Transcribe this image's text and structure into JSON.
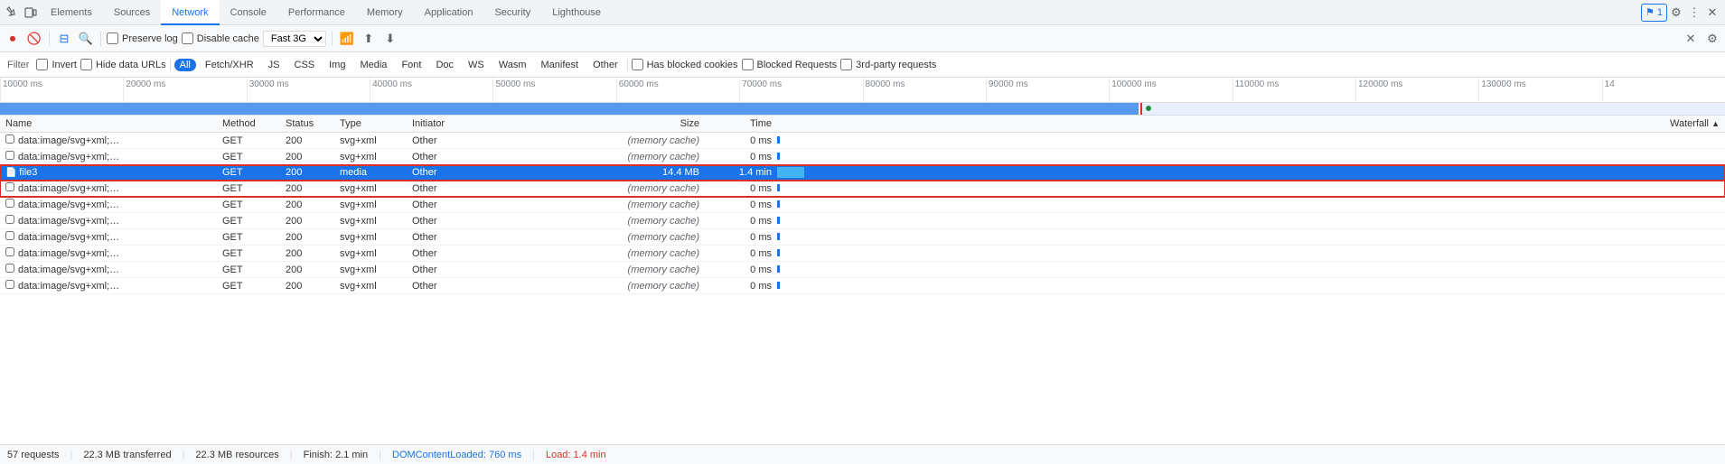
{
  "tabs": [
    {
      "label": "Elements",
      "active": false
    },
    {
      "label": "Sources",
      "active": false
    },
    {
      "label": "Network",
      "active": true,
      "hasWarning": false
    },
    {
      "label": "Console",
      "active": false
    },
    {
      "label": "Performance",
      "active": false
    },
    {
      "label": "Memory",
      "active": false
    },
    {
      "label": "Application",
      "active": false
    },
    {
      "label": "Security",
      "active": false
    },
    {
      "label": "Lighthouse",
      "active": false
    }
  ],
  "toolbar": {
    "preserve_log": "Preserve log",
    "disable_cache": "Disable cache",
    "throttle": "Fast 3G"
  },
  "filter": {
    "label": "Filter",
    "invert": "Invert",
    "hide_data_urls": "Hide data URLs",
    "chips": [
      "All",
      "Fetch/XHR",
      "JS",
      "CSS",
      "Img",
      "Media",
      "Font",
      "Doc",
      "WS",
      "Wasm",
      "Manifest",
      "Other"
    ],
    "active_chip": "All",
    "has_blocked_cookies": "Has blocked cookies",
    "blocked_requests": "Blocked Requests",
    "third_party": "3rd-party requests"
  },
  "timeline": {
    "marks": [
      "10000 ms",
      "20000 ms",
      "30000 ms",
      "40000 ms",
      "50000 ms",
      "60000 ms",
      "70000 ms",
      "80000 ms",
      "90000 ms",
      "100000 ms",
      "110000 ms",
      "120000 ms",
      "130000 ms",
      "14"
    ]
  },
  "table": {
    "columns": [
      "Name",
      "Method",
      "Status",
      "Type",
      "Initiator",
      "Size",
      "Time",
      "Waterfall"
    ],
    "rows": [
      {
        "name": "data:image/svg+xml;…",
        "method": "GET",
        "status": "200",
        "type": "svg+xml",
        "initiator": "Other",
        "size": "(memory cache)",
        "time": "0 ms",
        "selected": false,
        "hasIcon": false
      },
      {
        "name": "data:image/svg+xml;…",
        "method": "GET",
        "status": "200",
        "type": "svg+xml",
        "initiator": "Other",
        "size": "(memory cache)",
        "time": "0 ms",
        "selected": false,
        "hasIcon": false
      },
      {
        "name": "file3",
        "method": "GET",
        "status": "200",
        "type": "media",
        "initiator": "Other",
        "size": "14.4 MB",
        "time": "1.4 min",
        "selected": true,
        "hasIcon": true,
        "redBox": true
      },
      {
        "name": "data:image/svg+xml;…",
        "method": "GET",
        "status": "200",
        "type": "svg+xml",
        "initiator": "Other",
        "size": "(memory cache)",
        "time": "0 ms",
        "selected": false,
        "hasIcon": false,
        "redBox": true
      },
      {
        "name": "data:image/svg+xml;…",
        "method": "GET",
        "status": "200",
        "type": "svg+xml",
        "initiator": "Other",
        "size": "(memory cache)",
        "time": "0 ms",
        "selected": false,
        "hasIcon": false
      },
      {
        "name": "data:image/svg+xml;…",
        "method": "GET",
        "status": "200",
        "type": "svg+xml",
        "initiator": "Other",
        "size": "(memory cache)",
        "time": "0 ms",
        "selected": false,
        "hasIcon": false
      },
      {
        "name": "data:image/svg+xml;…",
        "method": "GET",
        "status": "200",
        "type": "svg+xml",
        "initiator": "Other",
        "size": "(memory cache)",
        "time": "0 ms",
        "selected": false,
        "hasIcon": false
      },
      {
        "name": "data:image/svg+xml;…",
        "method": "GET",
        "status": "200",
        "type": "svg+xml",
        "initiator": "Other",
        "size": "(memory cache)",
        "time": "0 ms",
        "selected": false,
        "hasIcon": false
      },
      {
        "name": "data:image/svg+xml;…",
        "method": "GET",
        "status": "200",
        "type": "svg+xml",
        "initiator": "Other",
        "size": "(memory cache)",
        "time": "0 ms",
        "selected": false,
        "hasIcon": false
      },
      {
        "name": "data:image/svg+xml;…",
        "method": "GET",
        "status": "200",
        "type": "svg+xml",
        "initiator": "Other",
        "size": "(memory cache)",
        "time": "0 ms",
        "selected": false,
        "hasIcon": false
      }
    ]
  },
  "statusbar": {
    "requests": "57 requests",
    "transferred": "22.3 MB transferred",
    "resources": "22.3 MB resources",
    "finish": "Finish: 2.1 min",
    "domcontent": "DOMContentLoaded: 760 ms",
    "load": "Load: 1.4 min"
  }
}
